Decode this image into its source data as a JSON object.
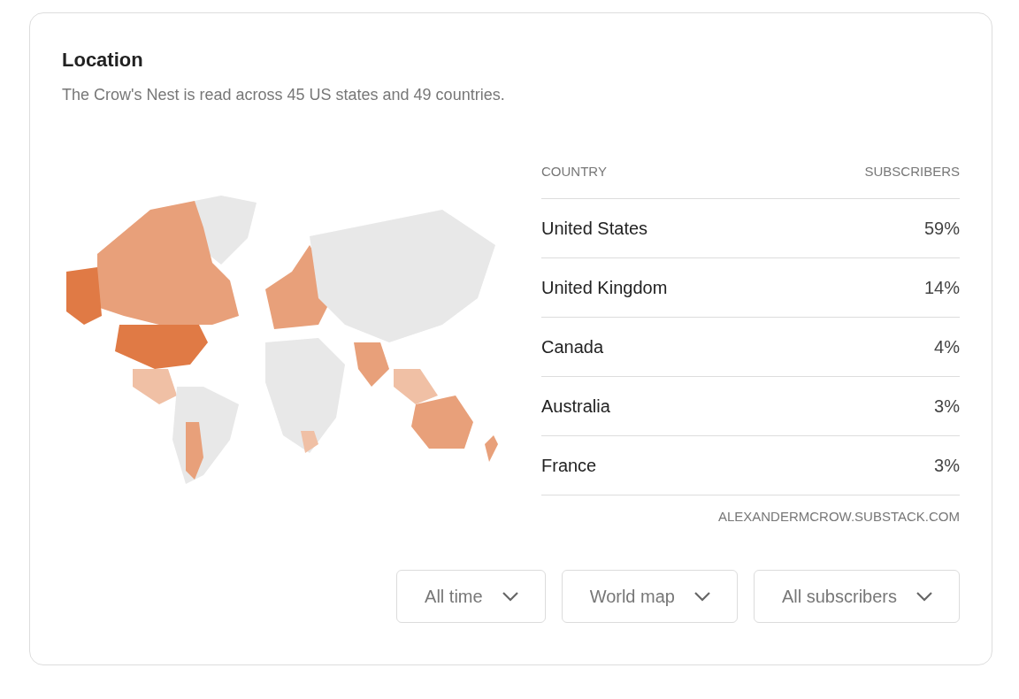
{
  "card": {
    "title": "Location",
    "subtitle": "The Crow's Nest is read across 45 US states and 49 countries."
  },
  "table": {
    "columns": [
      "COUNTRY",
      "SUBSCRIBERS"
    ],
    "rows": [
      {
        "country": "United States",
        "share": "59%"
      },
      {
        "country": "United Kingdom",
        "share": "14%"
      },
      {
        "country": "Canada",
        "share": "4%"
      },
      {
        "country": "Australia",
        "share": "3%"
      },
      {
        "country": "France",
        "share": "3%"
      }
    ]
  },
  "source": "ALEXANDERMCROW.SUBSTACK.COM",
  "dropdowns": [
    {
      "label": "All time"
    },
    {
      "label": "World map"
    },
    {
      "label": "All subscribers"
    }
  ]
}
